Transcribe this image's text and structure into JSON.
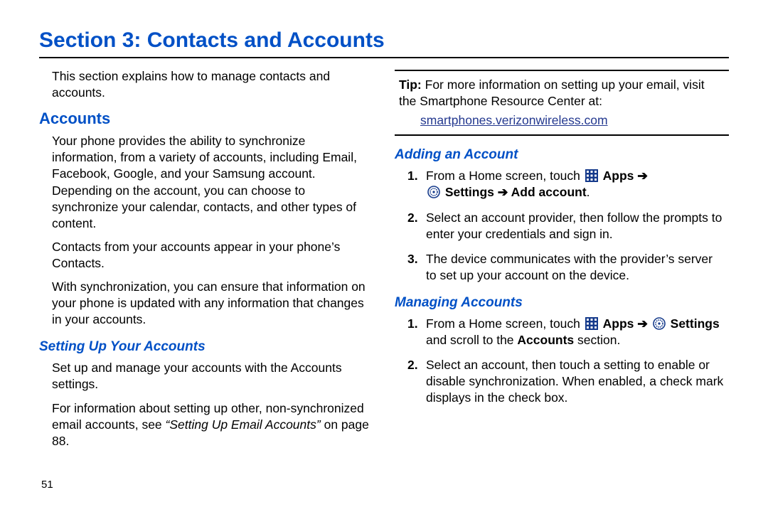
{
  "title": "Section 3: Contacts and Accounts",
  "intro": "This section explains how to manage contacts and accounts.",
  "accounts": {
    "heading": "Accounts",
    "p1": "Your phone provides the ability to synchronize information, from a variety of accounts, including Email, Facebook, Google, and your Samsung account. Depending on the account, you can choose to synchronize your calendar, contacts, and other types of content.",
    "p2": "Contacts from your accounts appear in your phone’s Contacts.",
    "p3": "With synchronization, you can ensure that information on your phone is updated with any information that changes in your accounts."
  },
  "setup": {
    "heading": "Setting Up Your Accounts",
    "p1": "Set up and manage your accounts with the Accounts settings.",
    "p2_pre": "For information about setting up other, non-synchronized email accounts, see ",
    "p2_ref": "“Setting Up Email Accounts”",
    "p2_post": " on page 88."
  },
  "tip": {
    "label": "Tip:",
    "text": " For more information on setting up your email, visit the Smartphone Resource Center at:",
    "link": "smartphones.verizonwireless.com"
  },
  "adding": {
    "heading": "Adding an Account",
    "step1_pre": "From a Home screen, touch ",
    "step1_apps": "Apps",
    "step1_arrow": " ➔ ",
    "step1_settings": "Settings",
    "step1_arrow2": " ➔ ",
    "step1_add": "Add account",
    "step1_period": ".",
    "step2": "Select an account provider, then follow the prompts to enter your credentials and sign in.",
    "step3": "The device communicates with the provider’s server to set up your account on the device."
  },
  "managing": {
    "heading": "Managing Accounts",
    "step1_pre": "From a Home screen, touch ",
    "step1_apps": "Apps",
    "step1_arrow": " ➔ ",
    "step1_settings": "Settings",
    "step1_post1": " and scroll to the ",
    "step1_accounts": "Accounts",
    "step1_post2": " section.",
    "step2": "Select an account, then touch a setting to enable or disable synchronization. When enabled, a check mark displays in the check box."
  },
  "page_number": "51"
}
